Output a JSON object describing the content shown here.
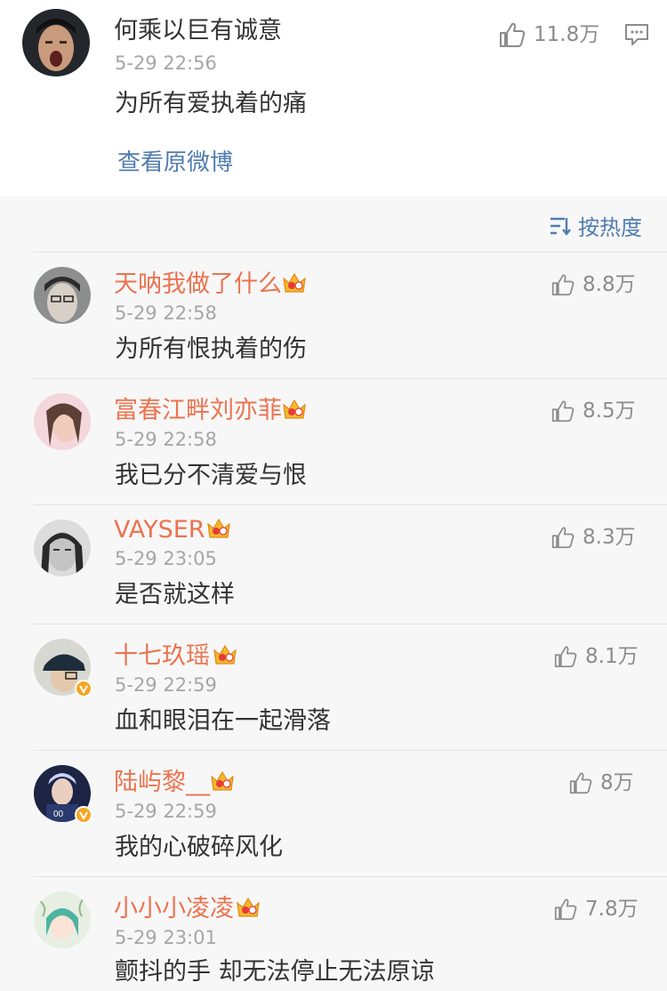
{
  "post": {
    "username": "何乘以巨有诚意",
    "time": "5-29 22:56",
    "text": "为所有爱执着的痛",
    "likes": "11.8万",
    "view_original": "查看原微博"
  },
  "sort": {
    "label": "按热度"
  },
  "comments": [
    {
      "username": "天呐我做了什么",
      "time": "5-29 22:58",
      "text": "为所有恨执着的伤",
      "likes": "8.8万"
    },
    {
      "username": "富春江畔刘亦菲",
      "time": "5-29 22:58",
      "text": "我已分不清爱与恨",
      "likes": "8.5万"
    },
    {
      "username": "VAYSER",
      "time": "5-29 23:05",
      "text": "是否就这样",
      "likes": "8.3万"
    },
    {
      "username": "十七玖瑶",
      "time": "5-29 22:59",
      "text": "血和眼泪在一起滑落",
      "likes": "8.1万"
    },
    {
      "username": "陆屿黎__",
      "time": "5-29 22:59",
      "text": "我的心破碎风化",
      "likes": "8万"
    },
    {
      "username": "小小小凌凌",
      "time": "5-29 23:01",
      "text": "颤抖的手 却无法停止无法原谅",
      "likes": "7.8万"
    }
  ],
  "colors": {
    "username": "#eb7350",
    "link": "#507daf",
    "muted": "#a6a6a6"
  }
}
